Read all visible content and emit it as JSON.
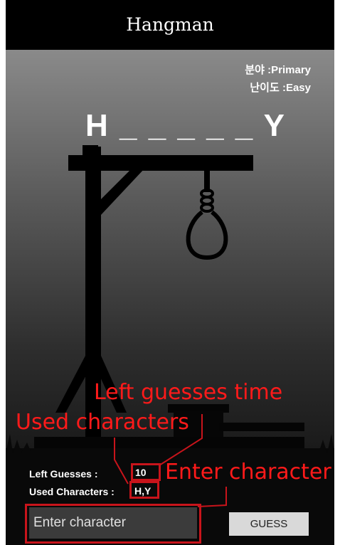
{
  "app": {
    "title": "Hangman"
  },
  "info": {
    "category_label": "분야 :",
    "category": "Primary",
    "difficulty_label": "난이도 :",
    "difficulty": "Easy"
  },
  "puzzle": {
    "display": "H _ _ _ _ _ Y"
  },
  "stats": {
    "left_guesses_label": "Left Guesses :",
    "left_guesses": "10",
    "used_characters_label": "Used Characters :",
    "used_characters": "H,Y"
  },
  "input": {
    "placeholder": "Enter character"
  },
  "guess_button": {
    "label": "GUESS"
  },
  "annotations": {
    "left_guesses": "Left guesses time",
    "used_characters": "Used characters",
    "enter_character": "Enter character"
  },
  "colors": {
    "annotation": "#c8141b",
    "stage_top": "#8a8a8a",
    "stage_bottom": "#0b0b0b"
  }
}
